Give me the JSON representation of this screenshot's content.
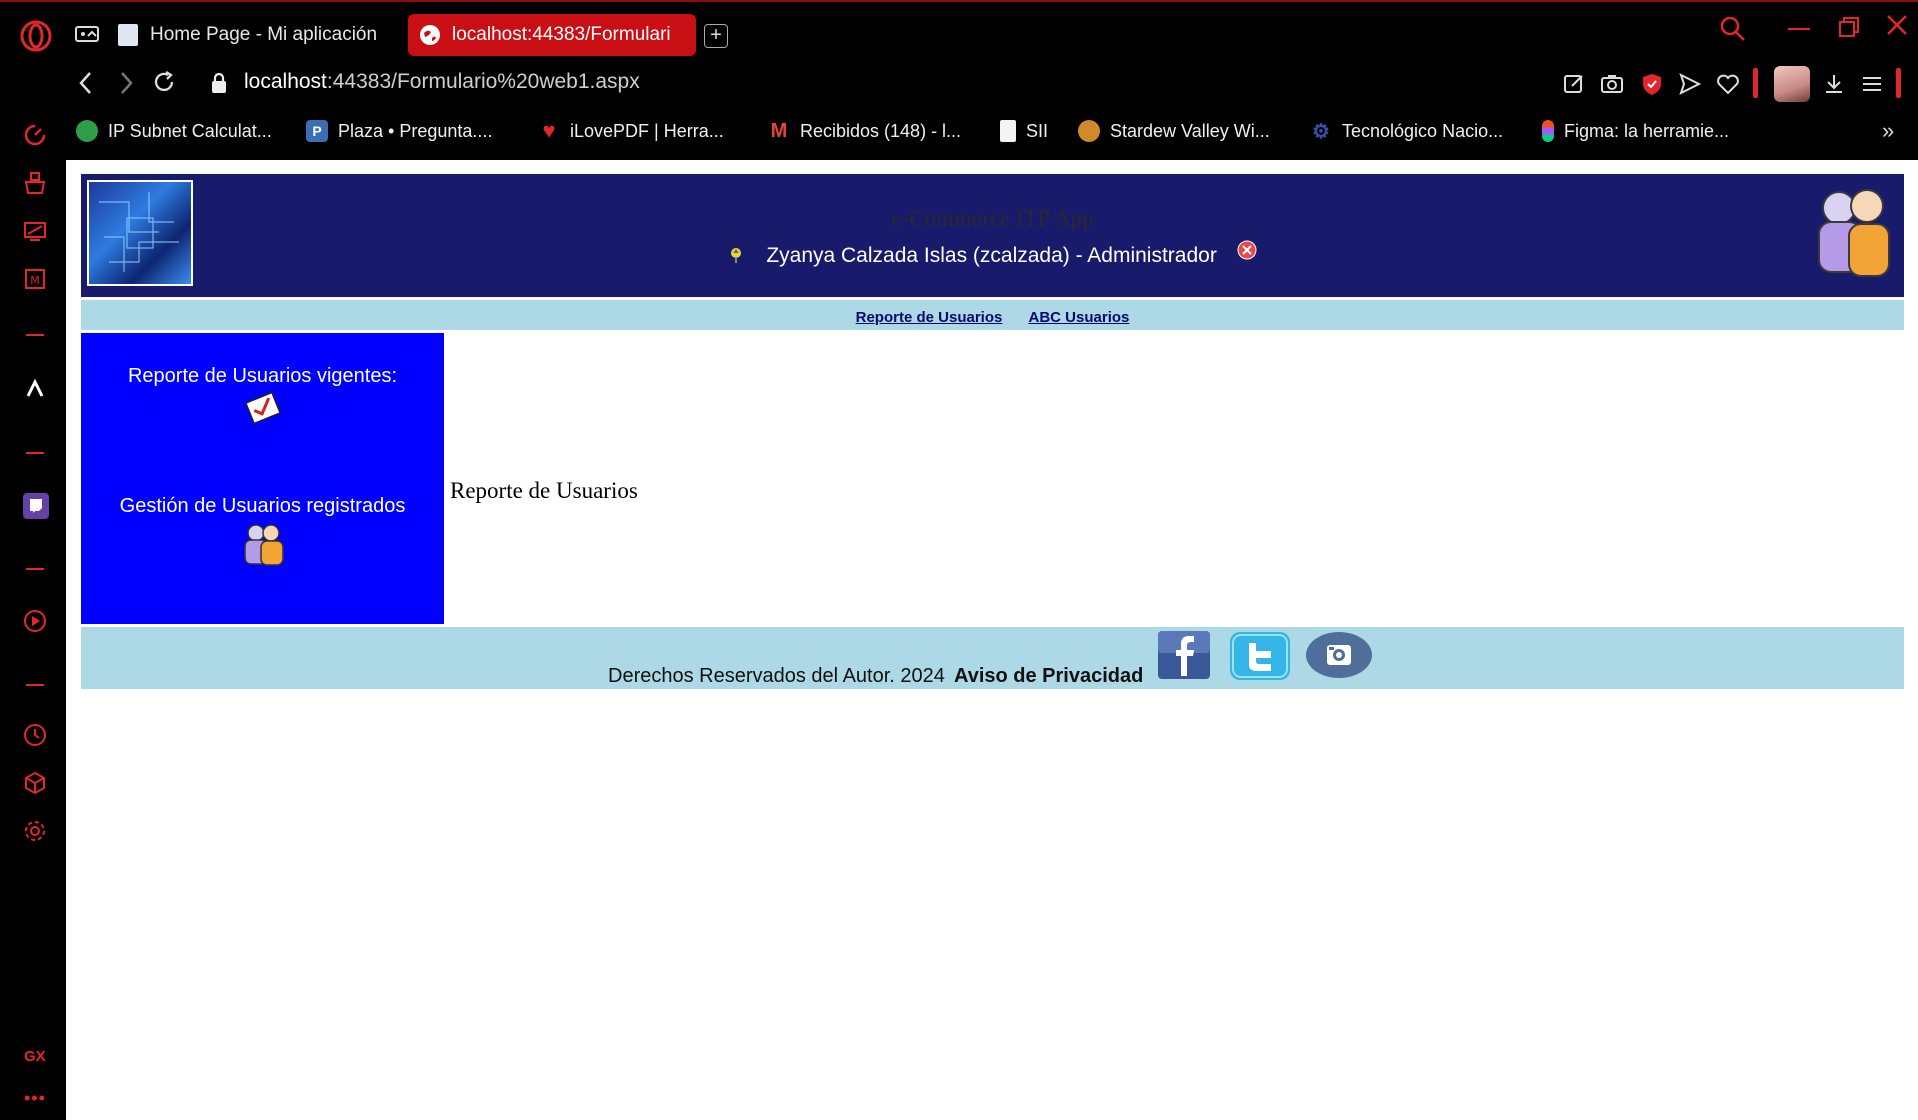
{
  "browser": {
    "tabs": [
      {
        "label": "Home Page - Mi aplicación"
      },
      {
        "label": "localhost:44383/Formulari"
      }
    ],
    "address": {
      "host": "localhost",
      "path": ":44383/Formulario%20web1.aspx"
    },
    "bookmarks": [
      {
        "label": "IP Subnet Calculat...",
        "icon": "globe-icon"
      },
      {
        "label": "Plaza • Pregunta....",
        "icon": "p-icon"
      },
      {
        "label": "iLovePDF | Herra...",
        "icon": "heart-icon"
      },
      {
        "label": "Recibidos (148) - l...",
        "icon": "gmail-icon"
      },
      {
        "label": "SII",
        "icon": "document-icon"
      },
      {
        "label": "Stardew Valley Wi...",
        "icon": "chicken-icon"
      },
      {
        "label": "Tecnológico Nacio...",
        "icon": "gear-icon"
      },
      {
        "label": "Figma: la herramie...",
        "icon": "figma-icon"
      }
    ],
    "sidebar_label": "GX",
    "accent": "#e3262b"
  },
  "page": {
    "app_title": "e-Commerce ITP App",
    "user_line": "Zyanya Calzada Islas (zcalzada) - Administrador",
    "menu": [
      {
        "label": "Reporte de Usuarios"
      },
      {
        "label": "ABC Usuarios"
      }
    ],
    "left_panel": {
      "report_label": "Reporte de Usuarios vigentes:",
      "manage_label": "Gestión de Usuarios registrados"
    },
    "content_title": "Reporte de Usuarios",
    "footer": {
      "copyright": "Derechos Reservados del Autor. 2024",
      "privacy": "Aviso de Privacidad",
      "social": [
        "facebook-icon",
        "twitter-icon",
        "instagram-icon"
      ]
    },
    "colors": {
      "header": "#181a6b",
      "menubar": "#add8e6",
      "panel": "#0000ff"
    }
  }
}
